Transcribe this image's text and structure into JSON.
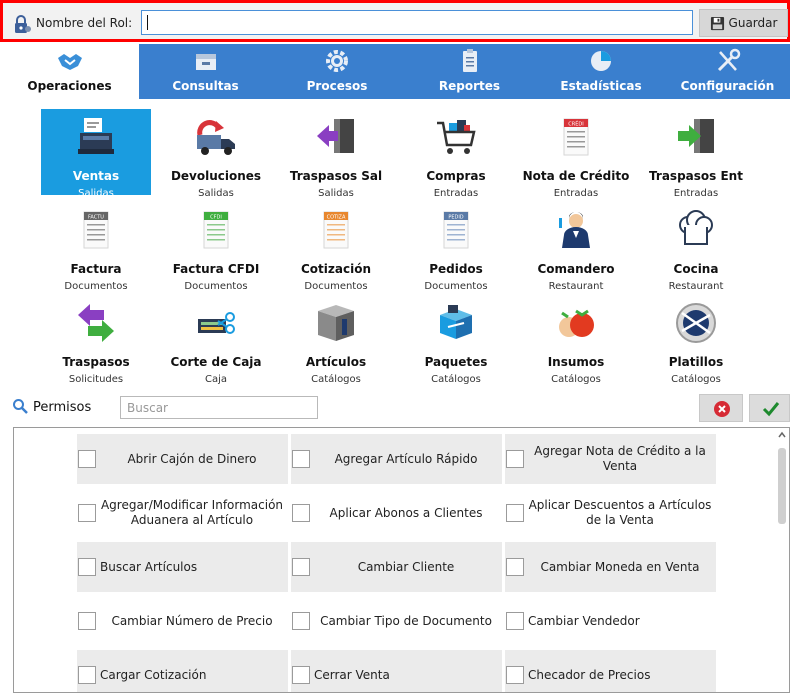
{
  "role_bar": {
    "label": "Nombre del Rol:",
    "value": "",
    "save_label": "Guardar"
  },
  "tabs": [
    {
      "label": "Operaciones",
      "icon": "handshake-icon",
      "active": true
    },
    {
      "label": "Consultas",
      "icon": "tray-icon"
    },
    {
      "label": "Procesos",
      "icon": "gear-icon"
    },
    {
      "label": "Reportes",
      "icon": "clipboard-icon"
    },
    {
      "label": "Estadísticas",
      "icon": "pie-chart-icon"
    },
    {
      "label": "Configuración",
      "icon": "tools-icon"
    }
  ],
  "modules": [
    {
      "title": "Ventas",
      "subtitle": "Salidas",
      "icon": "cash-register-icon",
      "selected": true
    },
    {
      "title": "Devoluciones",
      "subtitle": "Salidas",
      "icon": "delivery-truck-icon"
    },
    {
      "title": "Traspasos Sal",
      "subtitle": "Salidas",
      "icon": "exit-door-icon"
    },
    {
      "title": "Compras",
      "subtitle": "Entradas",
      "icon": "shopping-cart-icon"
    },
    {
      "title": "Nota de Crédito",
      "subtitle": "Entradas",
      "icon": "credit-note-icon",
      "badge": "CRÉDI"
    },
    {
      "title": "Traspasos Ent",
      "subtitle": "Entradas",
      "icon": "enter-door-icon"
    },
    {
      "title": "Factura",
      "subtitle": "Documentos",
      "icon": "invoice-icon",
      "badge": "FACTU"
    },
    {
      "title": "Factura CFDI",
      "subtitle": "Documentos",
      "icon": "cfdi-icon",
      "badge": "CFDI"
    },
    {
      "title": "Cotización",
      "subtitle": "Documentos",
      "icon": "quote-icon",
      "badge": "COTIZA"
    },
    {
      "title": "Pedidos",
      "subtitle": "Documentos",
      "icon": "order-icon",
      "badge": "PEDID"
    },
    {
      "title": "Comandero",
      "subtitle": "Restaurant",
      "icon": "waiter-icon"
    },
    {
      "title": "Cocina",
      "subtitle": "Restaurant",
      "icon": "chef-hat-icon"
    },
    {
      "title": "Traspasos",
      "subtitle": "Solicitudes",
      "icon": "transfer-arrows-icon"
    },
    {
      "title": "Corte de Caja",
      "subtitle": "Caja",
      "icon": "cash-cut-icon"
    },
    {
      "title": "Artículos",
      "subtitle": "Catálogos",
      "icon": "box-icon"
    },
    {
      "title": "Paquetes",
      "subtitle": "Catálogos",
      "icon": "packages-icon"
    },
    {
      "title": "Insumos",
      "subtitle": "Catálogos",
      "icon": "vegetables-icon"
    },
    {
      "title": "Platillos",
      "subtitle": "Catálogos",
      "icon": "plate-icon"
    }
  ],
  "permissions_bar": {
    "label": "Permisos",
    "search_placeholder": "Buscar"
  },
  "permissions": [
    "Abrir Cajón de Dinero",
    "Agregar Artículo Rápido",
    "Agregar Nota de Crédito a la Venta",
    "Agregar/Modificar Información Aduanera al Artículo",
    "Aplicar Abonos a Clientes",
    "Aplicar Descuentos a Artículos de la Venta",
    "Buscar Artículos",
    "Cambiar Cliente",
    "Cambiar Moneda en Venta",
    "Cambiar Número de Precio",
    "Cambiar Tipo de Documento",
    "Cambiar Vendedor",
    "Cargar Cotización",
    "Cerrar Venta",
    "Checador de Precios"
  ],
  "colors": {
    "tab_bar": "#3a7fce",
    "selected_module": "#1a9ce0",
    "focus_border": "#ff0000",
    "cancel": "#d62b35",
    "confirm": "#1e8a2e"
  }
}
